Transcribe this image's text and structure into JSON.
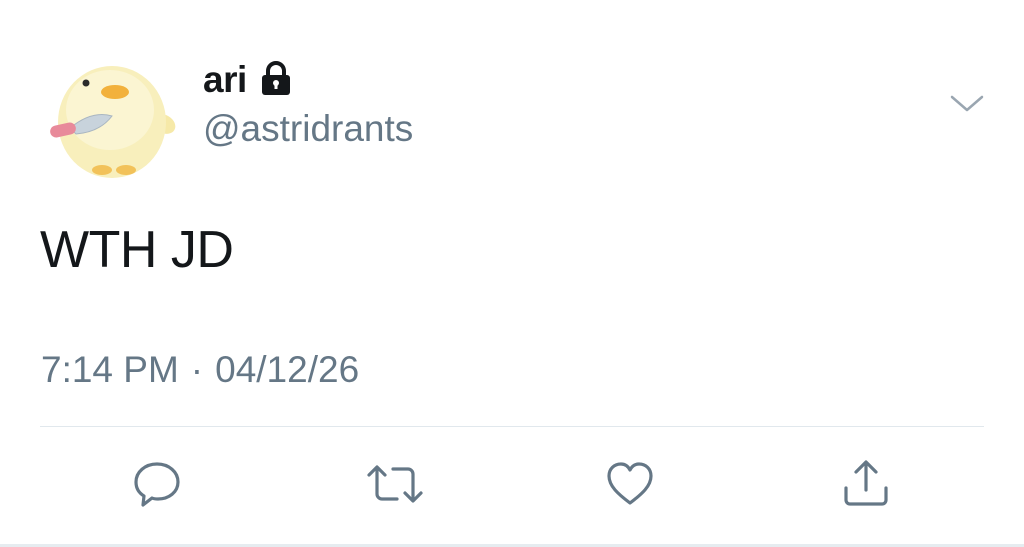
{
  "tweet": {
    "display_name": "ari",
    "handle": "@astridrants",
    "text": "WTH JD",
    "time": "7:14 PM",
    "separator": "·",
    "date": "04/12/26",
    "avatar": "yellow-chick-with-knife",
    "protected_account": true
  },
  "icons": {
    "lock": "lock-icon",
    "menu": "chevron-down-icon",
    "reply": "reply-icon",
    "retweet": "retweet-icon",
    "like": "heart-icon",
    "share": "share-icon"
  },
  "colors": {
    "text_primary": "#14171a",
    "text_secondary": "#657786",
    "divider": "#e1e8ed",
    "icon": "#657786"
  }
}
